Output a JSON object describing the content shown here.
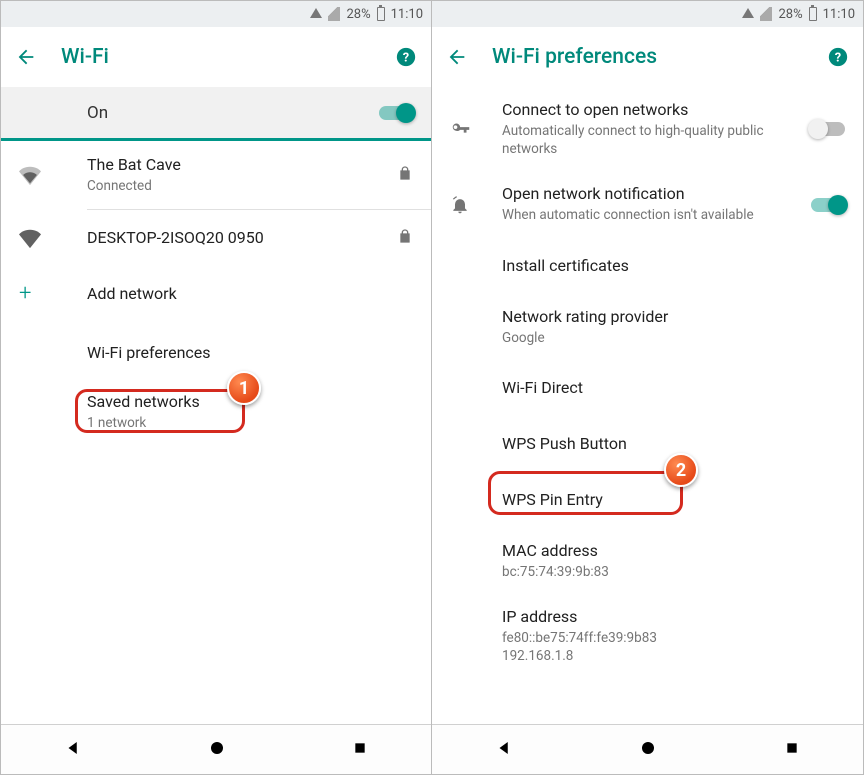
{
  "status": {
    "battery": "28%",
    "time": "11:10"
  },
  "left": {
    "title": "Wi-Fi",
    "toggle_label": "On",
    "networks": [
      {
        "ssid": "The Bat Cave",
        "status": "Connected"
      },
      {
        "ssid": "DESKTOP-2ISOQ20 0950",
        "status": ""
      }
    ],
    "add_network": "Add network",
    "wifi_prefs": "Wi-Fi preferences",
    "saved_networks": "Saved networks",
    "saved_networks_sub": "1 network"
  },
  "right": {
    "title": "Wi-Fi preferences",
    "open_net": {
      "title": "Connect to open networks",
      "sub": "Automatically connect to high-quality public networks"
    },
    "notify": {
      "title": "Open network notification",
      "sub": "When automatic connection isn't available"
    },
    "install_cert": "Install certificates",
    "rating": {
      "title": "Network rating provider",
      "sub": "Google"
    },
    "wifi_direct": "Wi-Fi Direct",
    "wps_push": "WPS Push Button",
    "wps_pin": "WPS Pin Entry",
    "mac": {
      "title": "MAC address",
      "value": "bc:75:74:39:9b:83"
    },
    "ip": {
      "title": "IP address",
      "value": "fe80::be75:74ff:fe39:9b83\n192.168.1.8"
    }
  },
  "callouts": {
    "one": "1",
    "two": "2"
  }
}
